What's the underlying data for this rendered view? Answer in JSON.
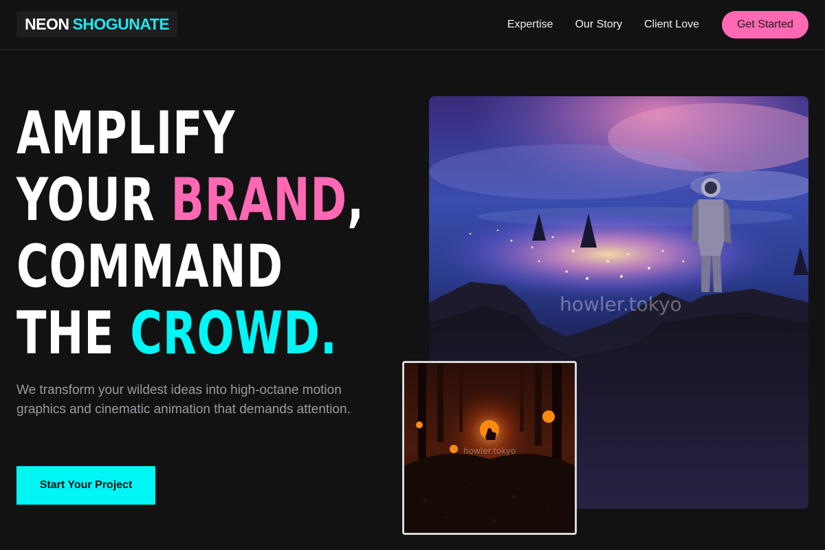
{
  "nav": {
    "logo_word1": "NEON",
    "logo_word2": "SHOGUNATE",
    "links": [
      {
        "label": "Expertise"
      },
      {
        "label": "Our Story"
      },
      {
        "label": "Client Love"
      }
    ],
    "cta_label": "Get Started"
  },
  "hero": {
    "headline_line1": "AMPLIFY",
    "headline_line2_a": "YOUR ",
    "headline_line2_b": "BRAND",
    "headline_line2_c": ",",
    "headline_line3": "COMMAND",
    "headline_line4_a": "THE ",
    "headline_line4_b": "CROWD.",
    "description": "We transform your wildest ideas into high-octane motion graphics and cinematic animation that demands attention.",
    "cta_label": "Start Your Project"
  },
  "images": {
    "main_watermark": "howler.tokyo",
    "thumb_watermark": "howler.tokyo"
  },
  "colors": {
    "accent_pink": "#ff69b4",
    "accent_cyan": "#00f5f5",
    "background": "#121212"
  }
}
